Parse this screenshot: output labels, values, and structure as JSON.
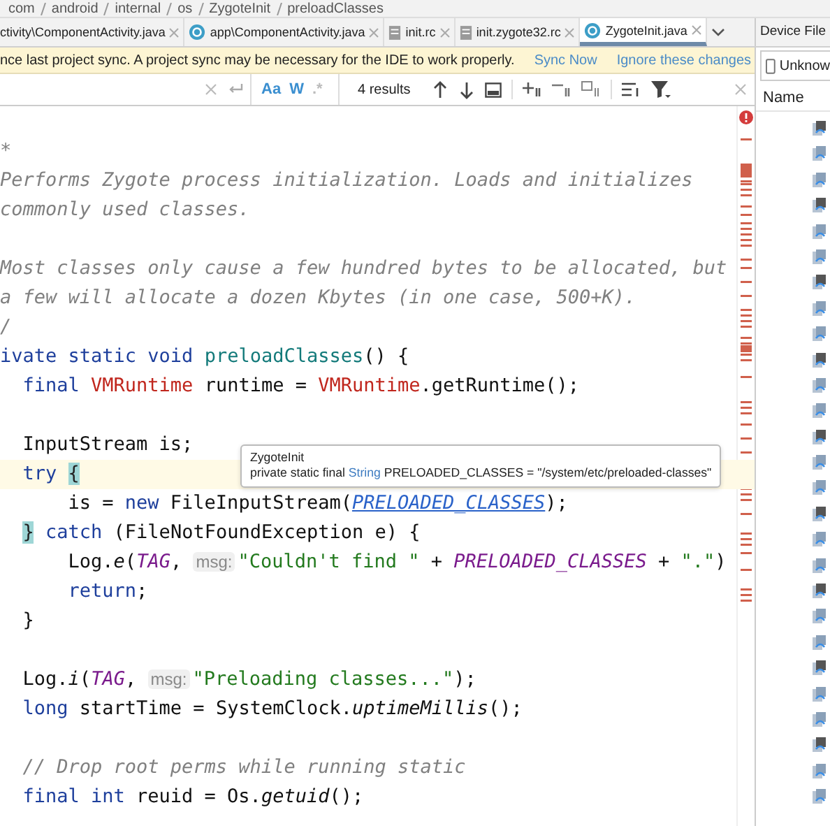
{
  "breadcrumbs": [
    "com",
    "android",
    "internal",
    "os",
    "ZygoteInit",
    "preloadClasses"
  ],
  "tabs": [
    {
      "label": "ctivity\\ComponentActivity.java",
      "selected": false
    },
    {
      "label": "app\\ComponentActivity.java",
      "kind": "class",
      "selected": false
    },
    {
      "label": "init.rc",
      "kind": "file",
      "selected": false
    },
    {
      "label": "init.zygote32.rc",
      "kind": "file",
      "selected": false
    },
    {
      "label": "ZygoteInit.java",
      "kind": "class",
      "selected": true
    }
  ],
  "side_panel": {
    "title": "Device File",
    "device": "Unknow",
    "column": "Name"
  },
  "notification": {
    "message": "nce last project sync. A project sync may be necessary for the IDE to work properly.",
    "actions": [
      "Sync Now",
      "Ignore these changes"
    ]
  },
  "find_bar": {
    "toggles": [
      {
        "label": "Aa",
        "selected": true
      },
      {
        "label": "W",
        "selected": true
      },
      {
        "label": ".*",
        "selected": false
      }
    ],
    "results": "4 results"
  },
  "tooltip": {
    "title": "ZygoteInit",
    "parts": [
      {
        "text": "private static final ",
        "kind": "plain"
      },
      {
        "text": "String",
        "kind": "type"
      },
      {
        "text": " PRELOADED_CLASSES = \"/system/etc/preloaded-classes\"",
        "kind": "plain"
      }
    ]
  },
  "code": [
    {
      "current": false,
      "tokens": [
        {
          "text": "*",
          "kind": "comment"
        }
      ]
    },
    {
      "current": false,
      "tokens": [
        {
          "text": "Performs Zygote process initialization. Loads and initializes",
          "kind": "comment"
        }
      ]
    },
    {
      "current": false,
      "tokens": [
        {
          "text": "commonly used classes.",
          "kind": "comment"
        }
      ]
    },
    {
      "current": false
    },
    {
      "current": false,
      "tokens": [
        {
          "text": "Most classes only cause a few hundred bytes to be allocated, but",
          "kind": "comment"
        }
      ]
    },
    {
      "current": false,
      "tokens": [
        {
          "text": "a few will allocate a dozen Kbytes (in one case, 500+K).",
          "kind": "comment"
        }
      ]
    },
    {
      "current": false,
      "tokens": [
        {
          "text": "/",
          "kind": "comment"
        }
      ]
    },
    {
      "current": false,
      "tokens": [
        {
          "text": "ivate static void ",
          "kind": "keyword"
        },
        {
          "text": "preloadClasses",
          "kind": "decl"
        },
        {
          "text": "() {",
          "kind": "plain"
        }
      ]
    },
    {
      "current": false,
      "tokens": [
        {
          "text": "  final ",
          "kind": "keyword"
        },
        {
          "text": "VMRuntime",
          "kind": "type"
        },
        {
          "text": " runtime = ",
          "kind": "plain"
        },
        {
          "text": "VMRuntime",
          "kind": "type"
        },
        {
          "text": ".getRuntime();",
          "kind": "plain"
        }
      ]
    },
    {
      "current": false
    },
    {
      "current": false,
      "tokens": [
        {
          "text": "  InputStream is;",
          "kind": "plain"
        }
      ]
    },
    {
      "current": true,
      "tokens": [
        {
          "text": "  try ",
          "kind": "keyword"
        },
        {
          "text": "{",
          "kind": "brace"
        }
      ]
    },
    {
      "current": false,
      "tokens": [
        {
          "text": "      is = ",
          "kind": "plain"
        },
        {
          "text": "new ",
          "kind": "keyword"
        },
        {
          "text": "FileInputStream(",
          "kind": "plain"
        },
        {
          "text": "PRELOADED_CLASSES",
          "kind": "link"
        },
        {
          "text": ");",
          "kind": "plain"
        }
      ]
    },
    {
      "current": false,
      "tokens": [
        {
          "text": "}",
          "kind": "brace"
        },
        {
          "text": " catch",
          "kind": "keyword"
        },
        {
          "text": " (FileNotFoundException e) {",
          "kind": "plain"
        }
      ]
    },
    {
      "current": false,
      "tokens": [
        {
          "text": "      Log.",
          "kind": "plain"
        },
        {
          "text": "e",
          "kind": "static-method"
        },
        {
          "text": "(",
          "kind": "plain"
        },
        {
          "text": "TAG",
          "kind": "static-field"
        },
        {
          "text": ", ",
          "kind": "plain"
        },
        {
          "text": "msg:",
          "kind": "hint"
        },
        {
          "text": "\"Couldn't find \"",
          "kind": "string"
        },
        {
          "text": " + ",
          "kind": "plain"
        },
        {
          "text": "PRELOADED_CLASSES",
          "kind": "static-field"
        },
        {
          "text": " + ",
          "kind": "plain"
        },
        {
          "text": "\".\"",
          "kind": "string"
        },
        {
          "text": ")",
          "kind": "plain"
        }
      ]
    },
    {
      "current": false,
      "tokens": [
        {
          "text": "      return",
          "kind": "keyword"
        },
        {
          "text": ";",
          "kind": "plain"
        }
      ]
    },
    {
      "current": false,
      "tokens": [
        {
          "text": "  }",
          "kind": "plain"
        }
      ]
    },
    {
      "current": false
    },
    {
      "current": false,
      "tokens": [
        {
          "text": "  Log.",
          "kind": "plain"
        },
        {
          "text": "i",
          "kind": "static-method"
        },
        {
          "text": "(",
          "kind": "plain"
        },
        {
          "text": "TAG",
          "kind": "static-field"
        },
        {
          "text": ", ",
          "kind": "plain"
        },
        {
          "text": "msg:",
          "kind": "hint"
        },
        {
          "text": "\"Preloading classes...\"",
          "kind": "string"
        },
        {
          "text": ");",
          "kind": "plain"
        }
      ]
    },
    {
      "current": false,
      "tokens": [
        {
          "text": "  long",
          "kind": "keyword"
        },
        {
          "text": " startTime = SystemClock.",
          "kind": "plain"
        },
        {
          "text": "uptimeMillis",
          "kind": "static-method"
        },
        {
          "text": "();",
          "kind": "plain"
        }
      ]
    },
    {
      "current": false
    },
    {
      "current": false,
      "tokens": [
        {
          "text": "  // Drop root perms while running static",
          "kind": "comment"
        }
      ]
    },
    {
      "current": false,
      "tokens": [
        {
          "text": "  final int",
          "kind": "keyword"
        },
        {
          "text": " reuid = Os.",
          "kind": "plain"
        },
        {
          "text": "getuid",
          "kind": "static-method"
        },
        {
          "text": "();",
          "kind": "plain"
        }
      ]
    }
  ]
}
